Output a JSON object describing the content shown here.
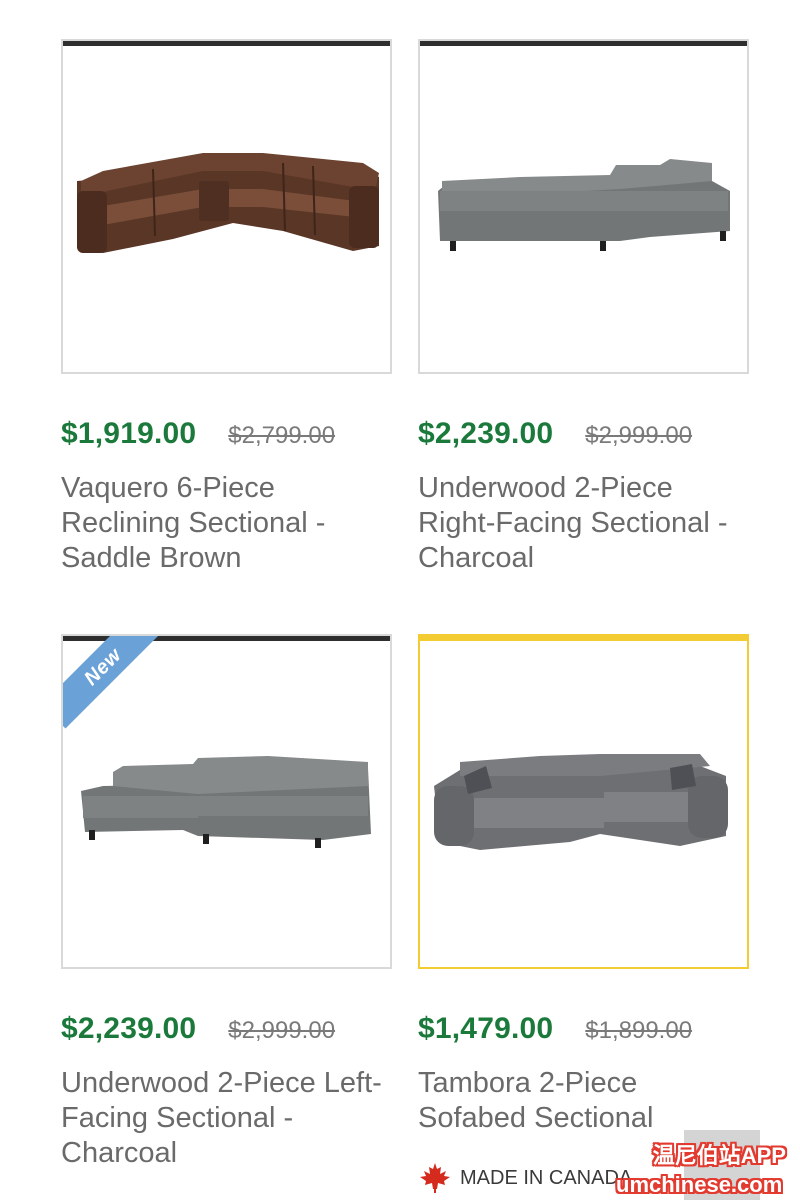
{
  "products": [
    {
      "price": "$1,919.00",
      "old_price": "$2,799.00",
      "title": "Vaquero 6-Piece Reclining Sectional - Saddle Brown",
      "image_icon": "brown-reclining-sectional-image",
      "badge": ""
    },
    {
      "price": "$2,239.00",
      "old_price": "$2,999.00",
      "title": "Underwood 2-Piece Right-Facing Sectional - Charcoal",
      "image_icon": "charcoal-right-facing-sectional-image",
      "badge": ""
    },
    {
      "price": "$2,239.00",
      "old_price": "$2,999.00",
      "title": "Underwood 2-Piece Left-Facing Sectional - Charcoal",
      "image_icon": "charcoal-left-facing-sectional-image",
      "badge": "New"
    },
    {
      "price": "$1,479.00",
      "old_price": "$1,899.00",
      "title": "Tambora 2-Piece Sofabed Sectional",
      "image_icon": "grey-sofabed-sectional-image",
      "badge": ""
    }
  ],
  "made_in_canada": "MADE IN CANADA",
  "watermark": {
    "line1": "温尼伯站APP",
    "line2": "umchinese.com"
  },
  "colors": {
    "price_green": "#1b7a3b",
    "card_topbar": "#2e2e2e",
    "featured_border": "#f3cb32",
    "new_badge": "#6aa2d8",
    "maple_leaf": "#d52b1e"
  }
}
